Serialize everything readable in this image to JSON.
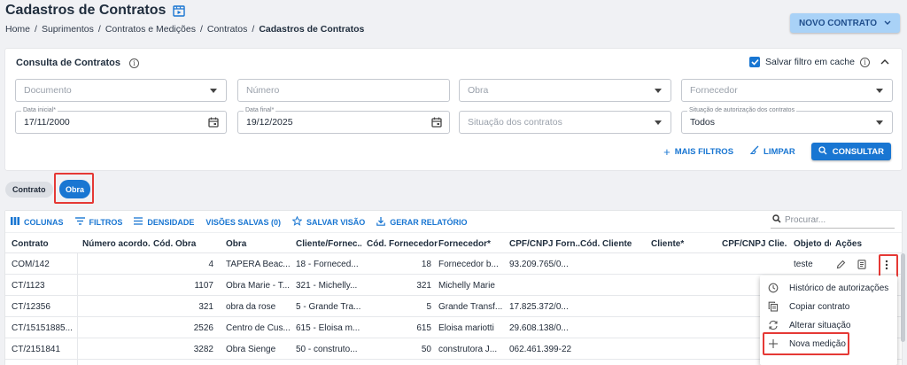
{
  "header": {
    "title": "Cadastros de Contratos",
    "breadcrumb": [
      "Home",
      "Suprimentos",
      "Contratos e Medições",
      "Contratos"
    ],
    "breadcrumb_current": "Cadastros de Contratos",
    "new_button": "NOVO CONTRATO"
  },
  "filter_panel": {
    "title": "Consulta de Contratos",
    "save_filter_label": "Salvar filtro em cache",
    "save_filter_checked": true,
    "fields": {
      "documento": {
        "placeholder": "Documento"
      },
      "numero": {
        "placeholder": "Número"
      },
      "obra": {
        "placeholder": "Obra"
      },
      "fornecedor": {
        "placeholder": "Fornecedor"
      },
      "data_inicial": {
        "label": "Data inicial*",
        "value": "17/11/2000"
      },
      "data_final": {
        "label": "Data final*",
        "value": "19/12/2025"
      },
      "situacao": {
        "placeholder": "Situação dos contratos"
      },
      "autorizacao": {
        "label": "Situação de autorização dos contratos",
        "value": "Todos"
      }
    },
    "actions": {
      "more_filters": "MAIS FILTROS",
      "clear": "LIMPAR",
      "consult": "CONSULTAR"
    }
  },
  "chips": {
    "contrato": "Contrato",
    "obra": "Obra"
  },
  "toolbar": {
    "columns": "COLUNAS",
    "filters": "FILTROS",
    "density": "DENSIDADE",
    "saved_views": "VISÕES SALVAS (0)",
    "save_view": "SALVAR VISÃO",
    "report": "GERAR RELATÓRIO",
    "search_placeholder": "Procurar..."
  },
  "table": {
    "columns": [
      "Contrato",
      "Número acordo...",
      "Cód. Obra",
      "Obra",
      "Cliente/Fornec...",
      "Cód. Fornecedor",
      "Fornecedor*",
      "CPF/CNPJ Forn...",
      "Cód. Cliente",
      "Cliente*",
      "CPF/CNPJ Clie...",
      "Objeto do",
      "Ações"
    ],
    "rows": [
      {
        "contrato": "COM/142",
        "acordo": "",
        "cod_obra": "4",
        "obra": "TAPERA Beac...",
        "cliente_fornec": "18 - Forneced...",
        "cod_forn": "18",
        "fornecedor": "Fornecedor b...",
        "cpf_forn": "93.209.765/0...",
        "objeto": "teste"
      },
      {
        "contrato": "CT/1123",
        "acordo": "",
        "cod_obra": "1107",
        "obra": "Obra Marie - T...",
        "cliente_fornec": "321 - Michelly...",
        "cod_forn": "321",
        "fornecedor": "Michelly Marie",
        "cpf_forn": "",
        "objeto": ""
      },
      {
        "contrato": "CT/12356",
        "acordo": "",
        "cod_obra": "321",
        "obra": "obra da rose",
        "cliente_fornec": "5 - Grande Tra...",
        "cod_forn": "5",
        "fornecedor": "Grande Transf...",
        "cpf_forn": "17.825.372/0...",
        "objeto": ""
      },
      {
        "contrato": "CT/15151885...",
        "acordo": "",
        "cod_obra": "2526",
        "obra": "Centro de Cus...",
        "cliente_fornec": "615 - Eloisa m...",
        "cod_forn": "615",
        "fornecedor": "Eloisa mariotti",
        "cpf_forn": "29.608.138/0...",
        "objeto": ""
      },
      {
        "contrato": "CT/2151841",
        "acordo": "",
        "cod_obra": "3282",
        "obra": "Obra Sienge",
        "cliente_fornec": "50 - construto...",
        "cod_forn": "50",
        "fornecedor": "construtora J...",
        "cpf_forn": "062.461.399-22",
        "objeto": ""
      }
    ]
  },
  "row_menu": {
    "items": [
      "Histórico de autorizações",
      "Copiar contrato",
      "Alterar situação",
      "Nova medição"
    ]
  },
  "colors": {
    "primary": "#1976d2",
    "new_button_bg": "#a9d2f7",
    "highlight": "#e53935"
  }
}
